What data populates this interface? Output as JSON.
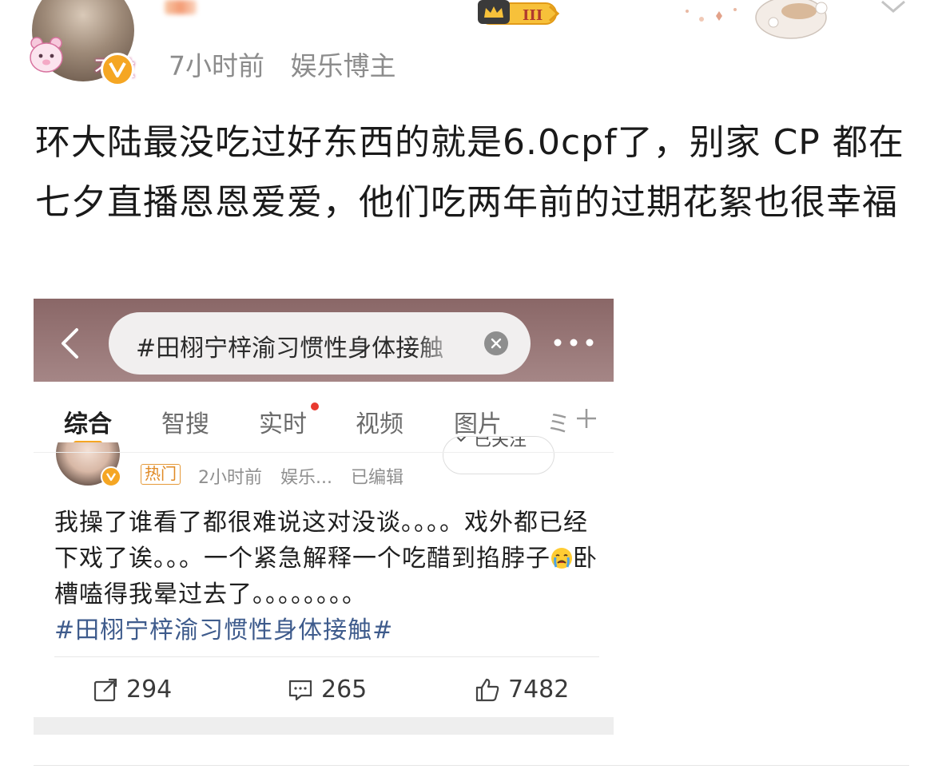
{
  "post": {
    "avatar_text": "不微",
    "verified_badge": "V",
    "level_badge": "III",
    "time": "7小时前",
    "category": "娱乐博主",
    "text": "环大陆最没吃过好东西的就是6.0cpf了，别家 CP 都在七夕直播恩恩爱爱，他们吃两年前的过期花絮也很幸福"
  },
  "screenshot": {
    "search_query": "#田栩宁梓渝习惯性身体接触",
    "tabs": [
      "综合",
      "智搜",
      "实时",
      "视频",
      "图片"
    ],
    "tab_more": "ミ",
    "active_tab": 0,
    "inner_post": {
      "verified_badge": "V",
      "hot_tag": "热门",
      "time": "2小时前",
      "source": "娱乐...",
      "edited": "已编辑",
      "follow_label": "已关注",
      "text_before_emoji": "我操了谁看了都很难说这对没谈。。。。戏外都已经下戏了诶。。。一个紧急解释一个吃醋到掐脖子",
      "text_after_emoji": "卧槽嗑得我晕过去了。。。。。。。。",
      "hashtag": "#田栩宁梓渝习惯性身体接触#",
      "reposts": "294",
      "comments": "265",
      "likes": "7482"
    }
  },
  "colors": {
    "accent": "#f5a623",
    "hashtag": "#3e5b8c",
    "topbar": "#8a6767",
    "meta_gray": "#8c8c8c"
  },
  "icons": [
    "bear-icon",
    "verified-v-icon",
    "crown-icon",
    "chevron-down-icon",
    "back-arrow-icon",
    "clear-icon",
    "more-dots-icon",
    "plus-icon",
    "repost-icon",
    "comment-icon",
    "like-icon",
    "crying-face-icon"
  ]
}
